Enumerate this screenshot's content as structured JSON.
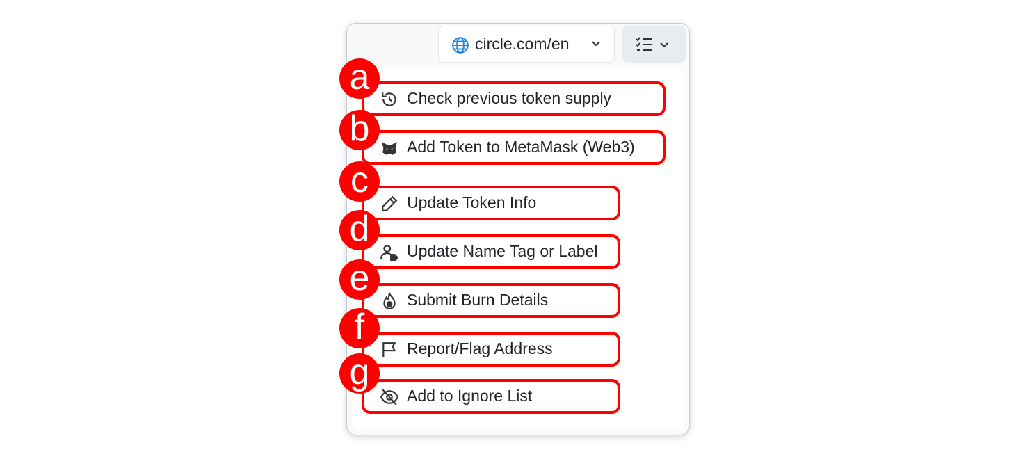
{
  "header": {
    "url_selector": {
      "label": "circle.com/en",
      "icon": "globe-icon"
    },
    "menu_toggle": {
      "icon": "list-check-icon"
    }
  },
  "menu": {
    "items": [
      {
        "badge": "a",
        "label": "Check previous token supply",
        "icon": "history-icon"
      },
      {
        "badge": "b",
        "label": "Add Token to MetaMask (Web3)",
        "icon": "metamask-fox-icon"
      },
      {
        "badge": "c",
        "label": "Update Token Info",
        "icon": "pencil-icon"
      },
      {
        "badge": "d",
        "label": "Update Name Tag or Label",
        "icon": "user-tag-icon"
      },
      {
        "badge": "e",
        "label": "Submit Burn Details",
        "icon": "fire-icon"
      },
      {
        "badge": "f",
        "label": "Report/Flag Address",
        "icon": "flag-icon"
      },
      {
        "badge": "g",
        "label": "Add to Ignore List",
        "icon": "eye-slash-icon"
      }
    ]
  },
  "colors": {
    "highlight": "#ff0000",
    "link_icon": "#1e88e5",
    "text": "#212529"
  }
}
